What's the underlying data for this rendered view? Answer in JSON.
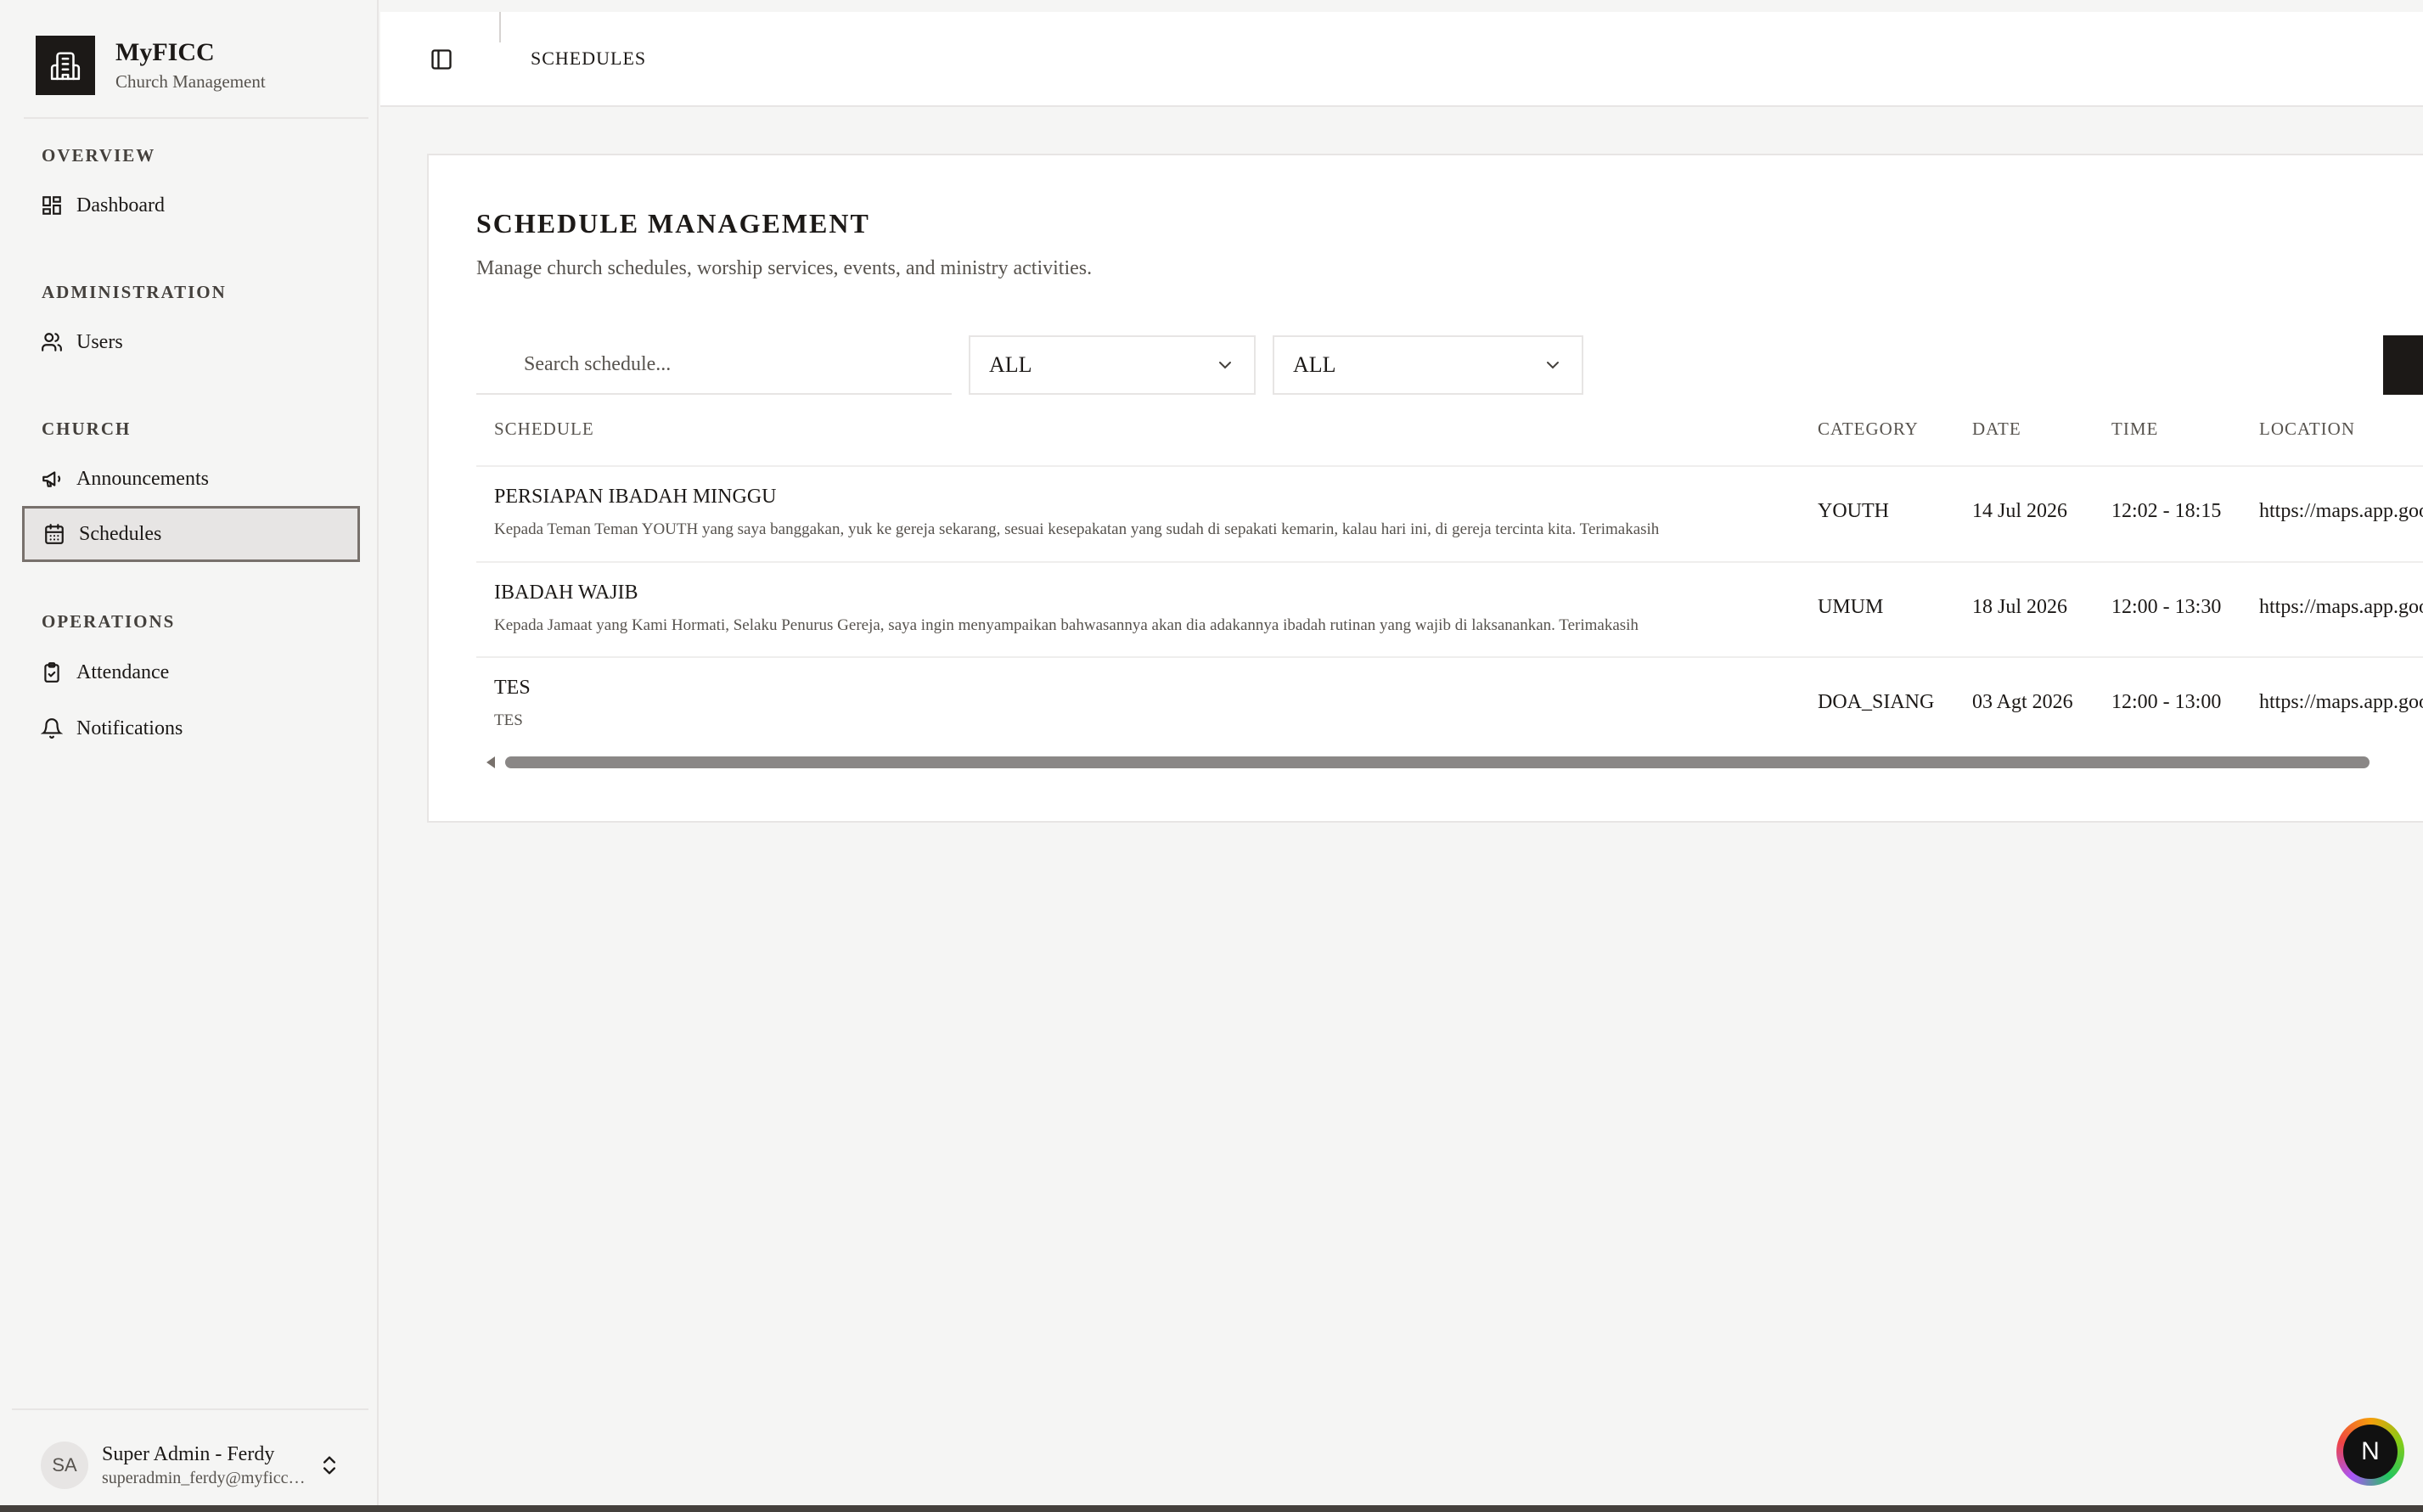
{
  "brand": {
    "name": "MyFICC",
    "subtitle": "Church Management"
  },
  "nav": {
    "groups": [
      {
        "label": "OVERVIEW",
        "items": [
          {
            "label": "Dashboard",
            "icon": "dashboard-icon"
          }
        ]
      },
      {
        "label": "ADMINISTRATION",
        "items": [
          {
            "label": "Users",
            "icon": "users-icon"
          }
        ]
      },
      {
        "label": "CHURCH",
        "items": [
          {
            "label": "Announcements",
            "icon": "megaphone-icon"
          },
          {
            "label": "Schedules",
            "icon": "calendar-icon",
            "active": true
          }
        ]
      },
      {
        "label": "OPERATIONS",
        "items": [
          {
            "label": "Attendance",
            "icon": "clipboard-check-icon"
          },
          {
            "label": "Notifications",
            "icon": "bell-icon"
          }
        ]
      }
    ]
  },
  "user": {
    "initials": "SA",
    "name": "Super Admin - Ferdy",
    "email": "superadmin_ferdy@myficc.com"
  },
  "header": {
    "title": "SCHEDULES"
  },
  "page": {
    "title": "SCHEDULE MANAGEMENT",
    "description": "Manage church schedules, worship services, events, and ministry activities."
  },
  "filters": {
    "search_placeholder": "Search schedule...",
    "category_value": "ALL",
    "status_value": "ALL"
  },
  "table": {
    "columns": [
      "SCHEDULE",
      "CATEGORY",
      "DATE",
      "TIME",
      "LOCATION"
    ],
    "rows": [
      {
        "title": "PERSIAPAN IBADAH MINGGU",
        "description": "Kepada Teman Teman YOUTH yang saya banggakan, yuk ke gereja sekarang, sesuai kesepakatan yang sudah di sepakati kemarin, kalau hari ini, di gereja tercinta kita. Terimakasih",
        "category": "YOUTH",
        "date": "14 Jul 2026",
        "time": "12:02 - 18:15",
        "location": "https://maps.app.goo.gl"
      },
      {
        "title": "IBADAH WAJIB",
        "description": "Kepada Jamaat yang Kami Hormati, Selaku Penurus Gereja, saya ingin menyampaikan bahwasannya akan dia adakannya ibadah rutinan yang wajib di laksanankan. Terimakasih",
        "category": "UMUM",
        "date": "18 Jul 2026",
        "time": "12:00 - 13:30",
        "location": "https://maps.app.goo.gl"
      },
      {
        "title": "TES",
        "description": "TES",
        "category": "DOA_SIANG",
        "date": "03 Agt 2026",
        "time": "12:00 - 13:00",
        "location": "https://maps.app.goo.gl"
      }
    ]
  },
  "fab": {
    "label": "N"
  }
}
